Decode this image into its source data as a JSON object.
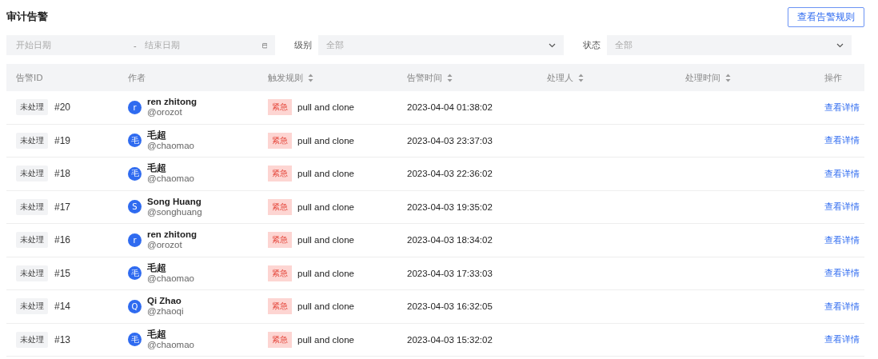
{
  "page_title": "审计告警",
  "rules_button": "查看告警规则",
  "filters": {
    "start_date": {
      "placeholder": "开始日期"
    },
    "separator": "-",
    "end_date": {
      "placeholder": "结束日期"
    },
    "level": {
      "label": "级别",
      "value": "全部"
    },
    "status": {
      "label": "状态",
      "value": "全部"
    }
  },
  "table": {
    "columns": [
      {
        "label": "告警ID",
        "sortable": false
      },
      {
        "label": "作者",
        "sortable": false
      },
      {
        "label": "触发规则",
        "sortable": true
      },
      {
        "label": "告警时间",
        "sortable": true
      },
      {
        "label": "处理人",
        "sortable": true
      },
      {
        "label": "处理时间",
        "sortable": true
      },
      {
        "label": "操作",
        "sortable": false
      }
    ],
    "rows": [
      {
        "status": "未处理",
        "id": "#20",
        "avatar": "r",
        "name": "ren zhitong",
        "handle": "@orozot",
        "severity": "紧急",
        "rule": "pull and clone",
        "time": "2023-04-04 01:38:02",
        "action": "查看详情"
      },
      {
        "status": "未处理",
        "id": "#19",
        "avatar": "毛",
        "name": "毛超",
        "handle": "@chaomao",
        "severity": "紧急",
        "rule": "pull and clone",
        "time": "2023-04-03 23:37:03",
        "action": "查看详情"
      },
      {
        "status": "未处理",
        "id": "#18",
        "avatar": "毛",
        "name": "毛超",
        "handle": "@chaomao",
        "severity": "紧急",
        "rule": "pull and clone",
        "time": "2023-04-03 22:36:02",
        "action": "查看详情"
      },
      {
        "status": "未处理",
        "id": "#17",
        "avatar": "S",
        "name": "Song Huang",
        "handle": "@songhuang",
        "severity": "紧急",
        "rule": "pull and clone",
        "time": "2023-04-03 19:35:02",
        "action": "查看详情"
      },
      {
        "status": "未处理",
        "id": "#16",
        "avatar": "r",
        "name": "ren zhitong",
        "handle": "@orozot",
        "severity": "紧急",
        "rule": "pull and clone",
        "time": "2023-04-03 18:34:02",
        "action": "查看详情"
      },
      {
        "status": "未处理",
        "id": "#15",
        "avatar": "毛",
        "name": "毛超",
        "handle": "@chaomao",
        "severity": "紧急",
        "rule": "pull and clone",
        "time": "2023-04-03 17:33:03",
        "action": "查看详情"
      },
      {
        "status": "未处理",
        "id": "#14",
        "avatar": "Q",
        "name": "Qi Zhao",
        "handle": "@zhaoqi",
        "severity": "紧急",
        "rule": "pull and clone",
        "time": "2023-04-03 16:32:05",
        "action": "查看详情"
      },
      {
        "status": "未处理",
        "id": "#13",
        "avatar": "毛",
        "name": "毛超",
        "handle": "@chaomao",
        "severity": "紧急",
        "rule": "pull and clone",
        "time": "2023-04-03 15:32:02",
        "action": "查看详情"
      }
    ]
  }
}
